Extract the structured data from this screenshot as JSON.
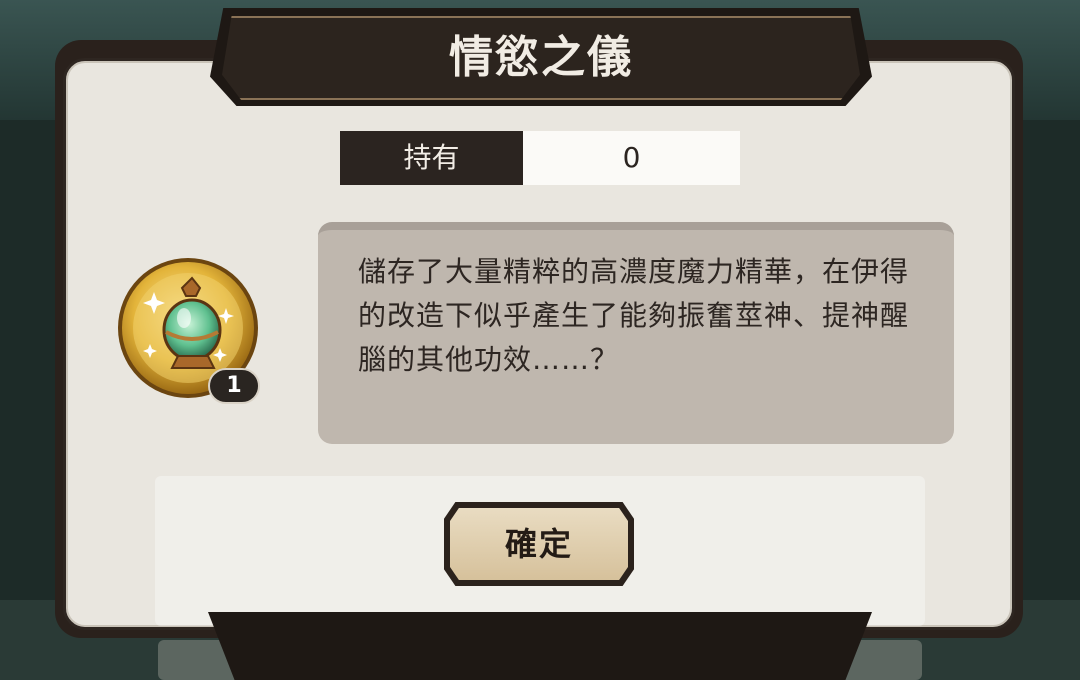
{
  "dialog": {
    "title": "情慾之儀",
    "owned_label": "持有",
    "owned_value": "0",
    "item": {
      "icon": "potion-bottle-icon",
      "count": "1"
    },
    "description": "儲存了大量精粹的高濃度魔力精華，在伊得的改造下似乎產生了能夠振奮莖神、提神醒腦的其他功效……？",
    "confirm_label": "確定"
  },
  "colors": {
    "frame": "#2a211c",
    "panel": "#e9e6df",
    "desc_box": "#bfb7ae",
    "button_gold": "#d6c19b",
    "potion_green": "#5fc08f",
    "coin_gold": "#e3b43a"
  }
}
